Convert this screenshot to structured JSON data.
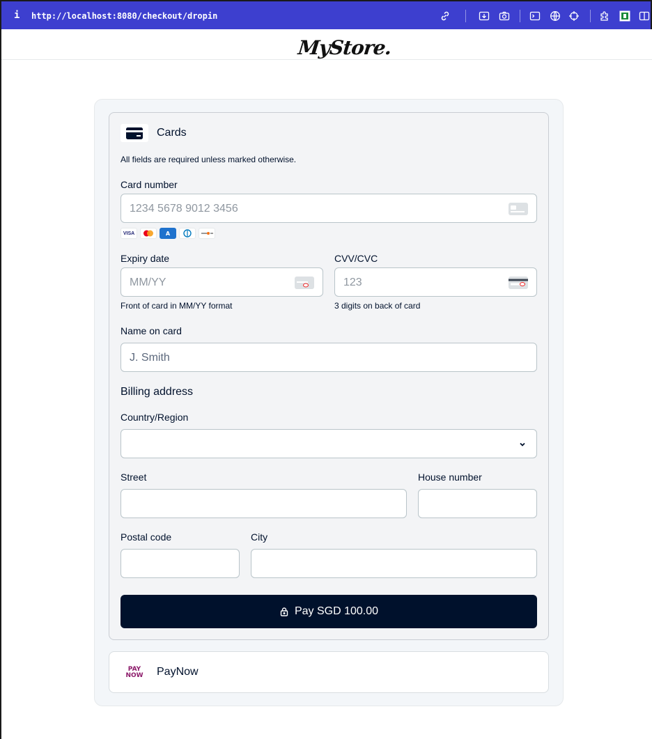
{
  "browser": {
    "info_glyph": "i",
    "url": "http://localhost:8080/checkout/dropin"
  },
  "store": {
    "logo": "MyStore."
  },
  "cards": {
    "title": "Cards",
    "required_note": "All fields are required unless marked otherwise.",
    "card_number": {
      "label": "Card number",
      "placeholder": "1234 5678 9012 3456"
    },
    "brands": [
      "VISA",
      "MC",
      "AMEX",
      "DINERS",
      "DISCOVER"
    ],
    "expiry": {
      "label": "Expiry date",
      "placeholder": "MM/YY",
      "hint": "Front of card in MM/YY format"
    },
    "cvc": {
      "label": "CVV/CVC",
      "placeholder": "123",
      "hint": "3 digits on back of card"
    },
    "name_on_card": {
      "label": "Name on card",
      "value": "J. Smith"
    },
    "billing_title": "Billing address",
    "country": {
      "label": "Country/Region",
      "value": ""
    },
    "street": {
      "label": "Street"
    },
    "house_number": {
      "label": "House number"
    },
    "postal_code": {
      "label": "Postal code"
    },
    "city": {
      "label": "City"
    },
    "pay_label": "Pay SGD 100.00"
  },
  "paynow": {
    "logo_line1": "PAY",
    "logo_line2": "NOW",
    "title": "PayNow"
  },
  "colors": {
    "browser_bar": "#3d3fcf",
    "pay_button": "#00112c",
    "paynow_brand": "#8c1a6a"
  }
}
